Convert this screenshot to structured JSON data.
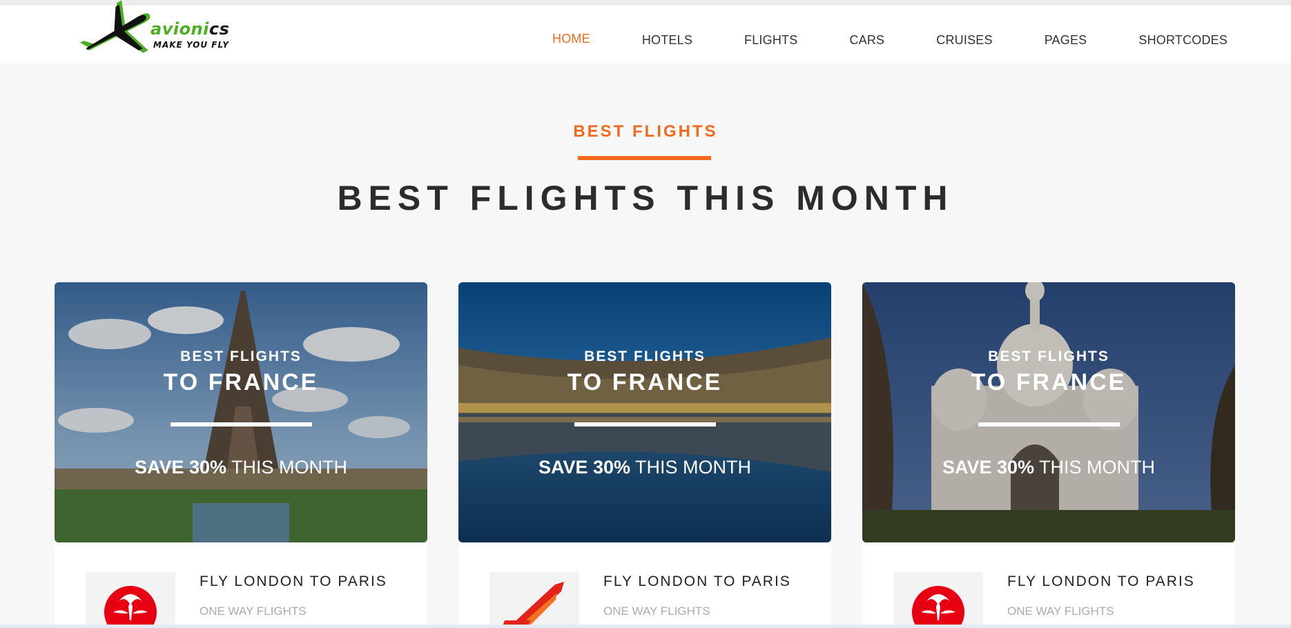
{
  "brand": {
    "name_part1": "avioni",
    "name_part2": "cs",
    "tagline": "MAKE YOU FLY",
    "accent_color": "#f26a1b",
    "logo_green": "#4caf1f"
  },
  "nav": {
    "items": [
      {
        "label": "HOME",
        "active": true
      },
      {
        "label": "HOTELS",
        "active": false
      },
      {
        "label": "FLIGHTS",
        "active": false
      },
      {
        "label": "CARS",
        "active": false
      },
      {
        "label": "CRUISES",
        "active": false
      },
      {
        "label": "PAGES",
        "active": false
      },
      {
        "label": "SHORTCODES",
        "active": false
      }
    ]
  },
  "section": {
    "label": "BEST FLIGHTS",
    "title": "BEST FLIGHTS THIS MONTH"
  },
  "cards": [
    {
      "image": "eiffel-tower-photo",
      "overlay_small": "BEST FLIGHTS",
      "overlay_big": "TO FRANCE",
      "save_bold": "SAVE 30%",
      "save_rest": " THIS MONTH",
      "airline_icon": "japan-airlines-crane-icon",
      "route": "FLY LONDON TO PARIS",
      "trip_type": "ONE WAY FLIGHTS"
    },
    {
      "image": "place-de-la-bourse-photo",
      "overlay_small": "BEST FLIGHTS",
      "overlay_big": "TO FRANCE",
      "save_bold": "SAVE 30%",
      "save_rest": " THIS MONTH",
      "airline_icon": "air-india-icon",
      "route": "FLY LONDON TO PARIS",
      "trip_type": "ONE WAY FLIGHTS"
    },
    {
      "image": "sacre-coeur-photo",
      "overlay_small": "BEST FLIGHTS",
      "overlay_big": "TO FRANCE",
      "save_bold": "SAVE 30%",
      "save_rest": " THIS MONTH",
      "airline_icon": "japan-airlines-crane-icon",
      "route": "FLY LONDON TO PARIS",
      "trip_type": "ONE WAY FLIGHTS"
    }
  ]
}
